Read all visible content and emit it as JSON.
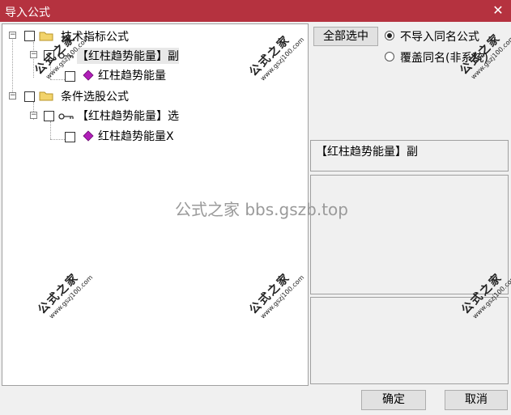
{
  "window": {
    "title": "导入公式",
    "close_icon": "close-icon"
  },
  "tree": {
    "nodes": [
      {
        "label": "技术指标公式",
        "icon": "folder-icon"
      },
      {
        "label": "【红柱趋势能量】副",
        "icon": "key-icon"
      },
      {
        "label": "红柱趋势能量",
        "icon": "gem-icon"
      },
      {
        "label": "条件选股公式",
        "icon": "folder-icon"
      },
      {
        "label": "【红柱趋势能量】选",
        "icon": "key-icon"
      },
      {
        "label": "红柱趋势能量X",
        "icon": "gem-icon"
      }
    ]
  },
  "right": {
    "select_all_label": "全部选中",
    "radio_options": [
      {
        "label": "不导入同名公式",
        "selected": true
      },
      {
        "label": "覆盖同名(非系统)",
        "selected": false
      }
    ],
    "selected_name": "【红柱趋势能量】副"
  },
  "footer": {
    "ok_label": "确定",
    "cancel_label": "取消"
  },
  "watermark": {
    "center_text": "公式之家 bbs.gszb.top",
    "stamp_cn": "公式之家",
    "stamp_url": "www.gszj100.com"
  },
  "colors": {
    "titlebar": "#b5323f",
    "gem": "#b01fb8"
  }
}
